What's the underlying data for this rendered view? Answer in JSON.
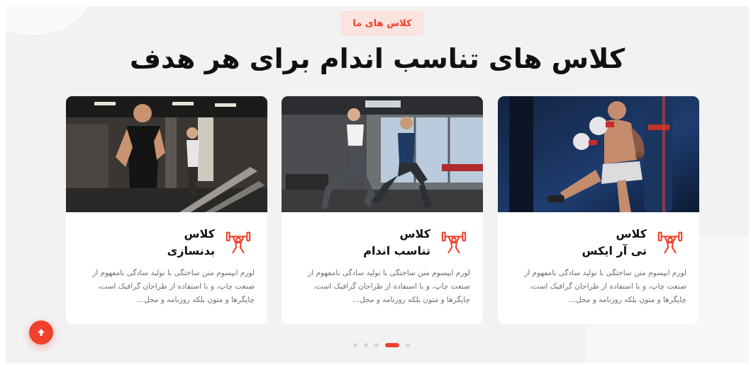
{
  "section": {
    "badge": "کلاس های ما",
    "title": "کلاس های تناسب اندام برای هر هدف"
  },
  "cards": [
    {
      "title_line1": "کلاس",
      "title_line2": "تی آر ایکس",
      "icon": "weightlifter-icon",
      "description": "لورم ایپسوم متن ساختگی با تولید سادگی نامفهوم از صنعت چاپ، و با استفاده از طراحان گرافیک است، چاپگرها و متون بلکه روزنامه و مجل..."
    },
    {
      "title_line1": "کلاس",
      "title_line2": "تناسب اندام",
      "icon": "weightlifter-icon",
      "description": "لورم ایپسوم متن ساختگی با تولید سادگی نامفهوم از صنعت چاپ، و با استفاده از طراحان گرافیک است، چاپگرها و متون بلکه روزنامه و مجل..."
    },
    {
      "title_line1": "کلاس",
      "title_line2": "بدنسازی",
      "icon": "weightlifter-icon",
      "description": "لورم ایپسوم متن ساختگی با تولید سادگی نامفهوم از صنعت چاپ، و با استفاده از طراحان گرافیک است، چاپگرها و متون بلکه روزنامه و مجل..."
    }
  ],
  "carousel": {
    "dot_count": 5,
    "active_index": 3
  },
  "colors": {
    "accent": "#f0412c",
    "badge_bg": "#fbe3df",
    "section_bg": "#f2f2f3"
  },
  "scroll_top": {
    "icon": "arrow-up-icon"
  }
}
